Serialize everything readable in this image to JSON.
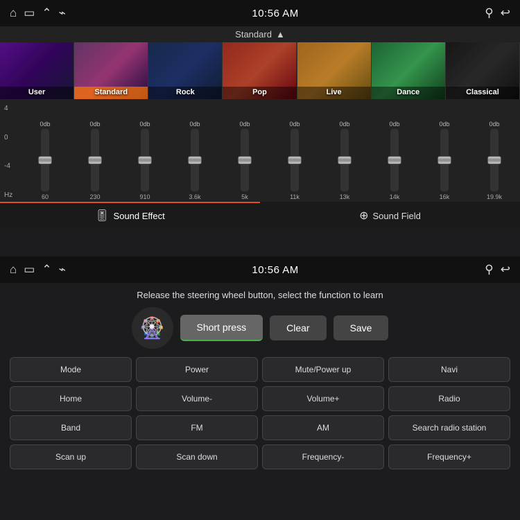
{
  "topPanel": {
    "statusBar": {
      "time": "10:56 AM",
      "icons": [
        "home",
        "screen",
        "chevron-up",
        "usb"
      ],
      "rightIcons": [
        "location",
        "back"
      ]
    },
    "presetHeader": {
      "label": "Standard",
      "chevron": "▲"
    },
    "presets": [
      {
        "id": "user",
        "label": "User",
        "active": false
      },
      {
        "id": "standard",
        "label": "Standard",
        "active": true
      },
      {
        "id": "rock",
        "label": "Rock",
        "active": false
      },
      {
        "id": "pop",
        "label": "Pop",
        "active": false
      },
      {
        "id": "live",
        "label": "Live",
        "active": false
      },
      {
        "id": "dance",
        "label": "Dance",
        "active": false
      },
      {
        "id": "classical",
        "label": "Classical",
        "active": false
      }
    ],
    "eqLabels": {
      "top": "4",
      "mid": "0",
      "bot": "-4",
      "unit": "Hz"
    },
    "eqBands": [
      {
        "hz": "60",
        "db": "0db"
      },
      {
        "hz": "230",
        "db": "0db"
      },
      {
        "hz": "910",
        "db": "0db"
      },
      {
        "hz": "3.6k",
        "db": "0db"
      },
      {
        "hz": "5k",
        "db": "0db"
      },
      {
        "hz": "11k",
        "db": "0db"
      },
      {
        "hz": "13k",
        "db": "0db"
      },
      {
        "hz": "14k",
        "db": "0db"
      },
      {
        "hz": "16k",
        "db": "0db"
      },
      {
        "hz": "19.9k",
        "db": "0db"
      }
    ],
    "tabs": [
      {
        "id": "sound-effect",
        "label": "Sound Effect",
        "icon": "🎚",
        "active": true
      },
      {
        "id": "sound-field",
        "label": "Sound Field",
        "icon": "⊕",
        "active": false
      }
    ]
  },
  "bottomPanel": {
    "statusBar": {
      "time": "10:56 AM"
    },
    "instruction": "Release the steering wheel button, select the function to learn",
    "controls": {
      "shortPress": "Short press",
      "clear": "Clear",
      "save": "Save"
    },
    "gridButtons": [
      "Mode",
      "Power",
      "Mute/Power up",
      "Navi",
      "Home",
      "Volume-",
      "Volume+",
      "Radio",
      "Band",
      "FM",
      "AM",
      "Search radio station",
      "Scan up",
      "Scan down",
      "Frequency-",
      "Frequency+"
    ]
  }
}
